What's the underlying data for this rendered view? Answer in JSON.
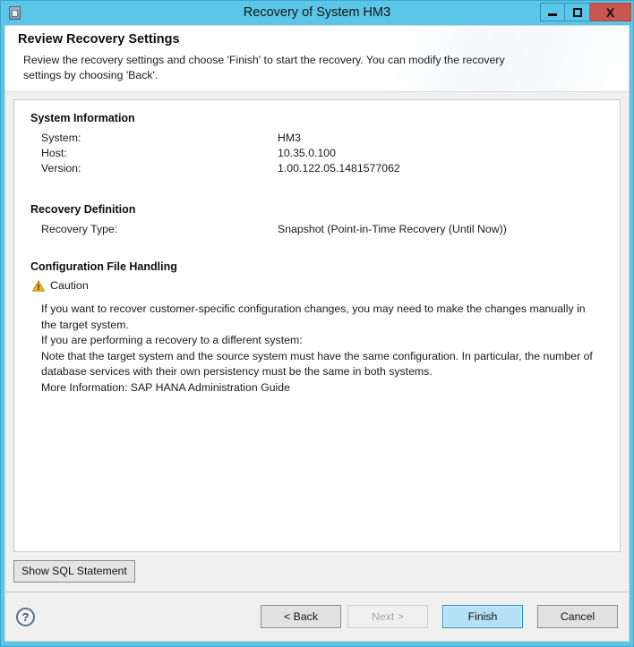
{
  "window": {
    "title": "Recovery of System HM3",
    "app_icon": "database-window-icon",
    "controls": {
      "minimize": "minimize-icon",
      "maximize": "maximize-icon",
      "close": "X"
    }
  },
  "banner": {
    "title": "Review Recovery Settings",
    "description": "Review the recovery settings and choose 'Finish' to start the recovery. You can modify the recovery settings by choosing 'Back'."
  },
  "sections": {
    "system_information": {
      "heading": "System Information",
      "rows": [
        {
          "key": "System:",
          "value": "HM3"
        },
        {
          "key": "Host:",
          "value": "10.35.0.100"
        },
        {
          "key": "Version:",
          "value": "1.00.122.05.1481577062"
        }
      ]
    },
    "recovery_definition": {
      "heading": "Recovery Definition",
      "rows": [
        {
          "key": "Recovery Type:",
          "value": "Snapshot (Point-in-Time Recovery (Until Now))"
        }
      ]
    },
    "configuration_file_handling": {
      "heading": "Configuration File Handling",
      "caution_label": "Caution",
      "caution_icon": "warning-triangle-icon",
      "paragraphs": [
        "If you want to recover customer-specific configuration changes, you may need to make the changes manually in the target system.",
        "If you are performing a recovery to a different system:",
        "Note that the target system and the source system must have the same configuration. In particular, the number of database services with their own persistency must be the same in both systems.",
        "More Information: SAP HANA Administration Guide"
      ]
    }
  },
  "toolbar": {
    "show_sql_label": "Show SQL Statement"
  },
  "footer": {
    "help_icon": "?",
    "back_label": "< Back",
    "next_label": "Next >",
    "finish_label": "Finish",
    "cancel_label": "Cancel"
  },
  "colors": {
    "titlebar": "#5bc6e8",
    "close_button": "#c7574f",
    "primary_button": "#b5e1f7",
    "warning": "#e9a820"
  }
}
